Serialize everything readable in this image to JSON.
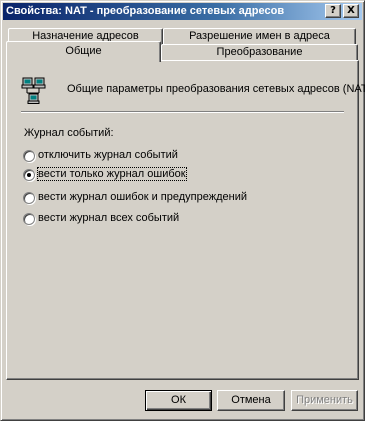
{
  "window": {
    "title": "Свойства: NAT - преобразование сетевых адресов",
    "help_button": "?",
    "close_button": "X"
  },
  "tabs": {
    "row_back": [
      {
        "label": "Назначение адресов"
      },
      {
        "label": "Разрешение имен в адреса"
      }
    ],
    "row_front": [
      {
        "label": "Общие",
        "active": true
      },
      {
        "label": "Преобразование"
      }
    ]
  },
  "general": {
    "icon": "network-computers-icon",
    "description": "Общие параметры преобразования сетевых адресов (NAT)",
    "event_log_label": "Журнал событий:",
    "options": [
      {
        "label": "отключить журнал событий",
        "checked": false
      },
      {
        "label": "вести только журнал ошибок",
        "checked": true
      },
      {
        "label": "вести журнал ошибок и предупреждений",
        "checked": false
      },
      {
        "label": "вести журнал всех событий",
        "checked": false
      }
    ]
  },
  "buttons": {
    "ok": "ОК",
    "cancel": "Отмена",
    "apply": "Применить"
  },
  "colors": {
    "face": "#d4d0c8",
    "title_start": "#0a246a",
    "title_end": "#a6caf0"
  }
}
